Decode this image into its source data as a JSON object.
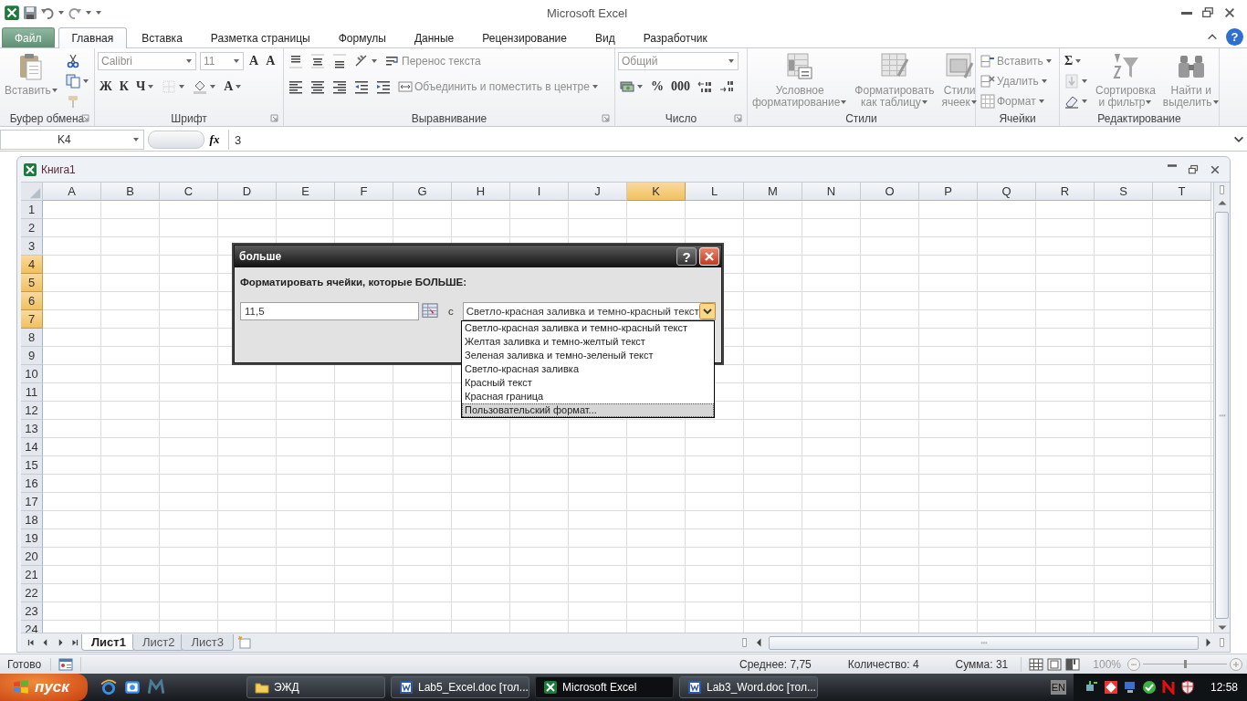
{
  "window": {
    "title": "Microsoft Excel"
  },
  "ribbon_tabs": [
    {
      "label": "Файл",
      "kind": "file",
      "selected": false
    },
    {
      "label": "Главная",
      "kind": "tab",
      "selected": true
    },
    {
      "label": "Вставка",
      "kind": "tab",
      "selected": false
    },
    {
      "label": "Разметка страницы",
      "kind": "tab",
      "selected": false
    },
    {
      "label": "Формулы",
      "kind": "tab",
      "selected": false
    },
    {
      "label": "Данные",
      "kind": "tab",
      "selected": false
    },
    {
      "label": "Рецензирование",
      "kind": "tab",
      "selected": false
    },
    {
      "label": "Вид",
      "kind": "tab",
      "selected": false
    },
    {
      "label": "Разработчик",
      "kind": "tab",
      "selected": false
    }
  ],
  "ribbon_help": "?",
  "ribbon_groups": [
    {
      "label": "Буфер обмена",
      "launcher": true,
      "items": [
        {
          "kind": "large",
          "label": "Вставить",
          "caret": true,
          "disabled": true
        },
        {
          "kind": "stack",
          "items": [
            {
              "kind": "icon",
              "caret": false,
              "disabled": false
            },
            {
              "kind": "icon",
              "caret": true,
              "disabled": false
            },
            {
              "kind": "icon",
              "caret": false,
              "disabled": true
            }
          ]
        }
      ]
    },
    {
      "label": "Шрифт",
      "launcher": true,
      "items": [
        {
          "kind": "rows",
          "lines": [
            {
              "items": [
                {
                  "kind": "combo",
                  "label": "Calibri",
                  "disabled": true
                },
                {
                  "kind": "combo",
                  "label": "11",
                  "disabled": true
                },
                {
                  "kind": "glyph",
                  "label": "A",
                  "caret": false,
                  "disabled": false
                },
                {
                  "kind": "glyph",
                  "label": "A",
                  "caret": false,
                  "disabled": false
                }
              ]
            },
            {
              "items": [
                {
                  "kind": "glyph",
                  "label": "Ж",
                  "caret": false,
                  "disabled": false
                },
                {
                  "kind": "glyph",
                  "label": "К",
                  "caret": false,
                  "disabled": false
                },
                {
                  "kind": "glyph",
                  "label": "Ч",
                  "caret": true,
                  "disabled": false
                },
                {
                  "kind": "icon",
                  "caret": true,
                  "disabled": true
                },
                {
                  "kind": "icon",
                  "caret": true,
                  "disabled": false
                },
                {
                  "kind": "glyph",
                  "label": "A",
                  "caret": true,
                  "disabled": false
                }
              ]
            }
          ]
        }
      ]
    },
    {
      "label": "Выравнивание",
      "launcher": true,
      "items": [
        {
          "kind": "rows",
          "lines": [
            {
              "items": [
                {
                  "kind": "icon",
                  "caret": false,
                  "disabled": false
                },
                {
                  "kind": "icon",
                  "caret": false,
                  "disabled": false
                },
                {
                  "kind": "icon",
                  "caret": false,
                  "disabled": false
                },
                {
                  "kind": "icon",
                  "caret": true,
                  "disabled": false
                },
                {
                  "kind": "labeled",
                  "label": "Перенос текста",
                  "caret": false,
                  "disabled": true
                }
              ]
            },
            {
              "items": [
                {
                  "kind": "icon",
                  "caret": false,
                  "disabled": false
                },
                {
                  "kind": "icon",
                  "caret": false,
                  "disabled": false
                },
                {
                  "kind": "icon",
                  "caret": false,
                  "disabled": false
                },
                {
                  "kind": "icon",
                  "caret": false,
                  "disabled": false
                },
                {
                  "kind": "icon",
                  "caret": false,
                  "disabled": false
                },
                {
                  "kind": "labeled",
                  "label": "Объединить и поместить в центре",
                  "caret": true,
                  "disabled": true
                }
              ]
            }
          ]
        }
      ]
    },
    {
      "label": "Число",
      "launcher": true,
      "items": [
        {
          "kind": "rows",
          "lines": [
            {
              "items": [
                {
                  "kind": "combo",
                  "label": "Общий",
                  "disabled": true
                }
              ]
            },
            {
              "items": [
                {
                  "kind": "icon",
                  "caret": true,
                  "disabled": false
                },
                {
                  "kind": "glyph",
                  "label": "%",
                  "caret": false,
                  "disabled": false
                },
                {
                  "kind": "glyph",
                  "label": "000",
                  "caret": false,
                  "disabled": false
                },
                {
                  "kind": "icon",
                  "caret": false,
                  "disabled": false
                },
                {
                  "kind": "icon",
                  "caret": false,
                  "disabled": false
                }
              ]
            }
          ]
        }
      ]
    },
    {
      "label": "Стили",
      "launcher": false,
      "items": [
        {
          "kind": "large",
          "label": "Условное\nформатирование",
          "caret": true,
          "disabled": true
        },
        {
          "kind": "large",
          "label": "Форматировать\nкак таблицу",
          "caret": true,
          "disabled": true
        },
        {
          "kind": "large",
          "label": "Стили\nячеек",
          "caret": true,
          "disabled": true
        }
      ]
    },
    {
      "label": "Ячейки",
      "launcher": false,
      "items": [
        {
          "kind": "stack",
          "items": [
            {
              "kind": "labeled",
              "label": "Вставить",
              "caret": true,
              "disabled": true
            },
            {
              "kind": "labeled",
              "label": "Удалить",
              "caret": true,
              "disabled": true
            },
            {
              "kind": "labeled",
              "label": "Формат",
              "caret": true,
              "disabled": true
            }
          ]
        }
      ]
    },
    {
      "label": "Редактирование",
      "launcher": false,
      "items": [
        {
          "kind": "stack",
          "items": [
            {
              "kind": "glyph",
              "label": "Σ",
              "caret": true,
              "disabled": false
            },
            {
              "kind": "icon",
              "caret": true,
              "disabled": true
            },
            {
              "kind": "icon",
              "caret": true,
              "disabled": false
            }
          ]
        },
        {
          "kind": "large",
          "label": "Сортировка\nи фильтр",
          "caret": true,
          "disabled": true
        },
        {
          "kind": "large",
          "label": "Найти и\nвыделить",
          "caret": true,
          "disabled": true
        }
      ]
    }
  ],
  "formula_bar": {
    "name_box": "K4",
    "function_button": "fx",
    "value": "3"
  },
  "workbook": {
    "title": "Книга1",
    "columns": [
      {
        "label": "A",
        "selected": false
      },
      {
        "label": "B",
        "selected": false
      },
      {
        "label": "C",
        "selected": false
      },
      {
        "label": "D",
        "selected": false
      },
      {
        "label": "E",
        "selected": false
      },
      {
        "label": "F",
        "selected": false
      },
      {
        "label": "G",
        "selected": false
      },
      {
        "label": "H",
        "selected": false
      },
      {
        "label": "I",
        "selected": false
      },
      {
        "label": "J",
        "selected": false
      },
      {
        "label": "K",
        "selected": true
      },
      {
        "label": "L",
        "selected": false
      },
      {
        "label": "M",
        "selected": false
      },
      {
        "label": "N",
        "selected": false
      },
      {
        "label": "O",
        "selected": false
      },
      {
        "label": "P",
        "selected": false
      },
      {
        "label": "Q",
        "selected": false
      },
      {
        "label": "R",
        "selected": false
      },
      {
        "label": "S",
        "selected": false
      },
      {
        "label": "T",
        "selected": false
      }
    ],
    "rows": [
      {
        "label": "1",
        "selected": false
      },
      {
        "label": "2",
        "selected": false
      },
      {
        "label": "3",
        "selected": false
      },
      {
        "label": "4",
        "selected": true
      },
      {
        "label": "5",
        "selected": true
      },
      {
        "label": "6",
        "selected": true
      },
      {
        "label": "7",
        "selected": true
      },
      {
        "label": "8",
        "selected": false
      },
      {
        "label": "9",
        "selected": false
      },
      {
        "label": "10",
        "selected": false
      },
      {
        "label": "11",
        "selected": false
      },
      {
        "label": "12",
        "selected": false
      },
      {
        "label": "13",
        "selected": false
      },
      {
        "label": "14",
        "selected": false
      },
      {
        "label": "15",
        "selected": false
      },
      {
        "label": "16",
        "selected": false
      },
      {
        "label": "17",
        "selected": false
      },
      {
        "label": "18",
        "selected": false
      },
      {
        "label": "19",
        "selected": false
      },
      {
        "label": "20",
        "selected": false
      },
      {
        "label": "21",
        "selected": false
      },
      {
        "label": "22",
        "selected": false
      },
      {
        "label": "23",
        "selected": false
      },
      {
        "label": "24",
        "selected": false
      }
    ],
    "sheets": [
      {
        "label": "Лист1",
        "selected": true
      },
      {
        "label": "Лист2",
        "selected": false
      },
      {
        "label": "Лист3",
        "selected": false
      }
    ]
  },
  "dialog": {
    "title": "больше",
    "help": "?",
    "prompt": "Форматировать ячейки, которые БОЛЬШЕ:",
    "value": "11,5",
    "connector": "с",
    "format": "Светло-красная заливка и темно-красный текст",
    "options": [
      {
        "label": "Светло-красная заливка и темно-красный текст",
        "selected": false
      },
      {
        "label": "Желтая заливка и темно-желтый текст",
        "selected": false
      },
      {
        "label": "Зеленая заливка и темно-зеленый текст",
        "selected": false
      },
      {
        "label": "Светло-красная заливка",
        "selected": false
      },
      {
        "label": "Красный текст",
        "selected": false
      },
      {
        "label": "Красная граница",
        "selected": false
      },
      {
        "label": "Пользовательский формат...",
        "selected": true
      }
    ]
  },
  "status_bar": {
    "mode": "Готово",
    "stats": [
      "Среднее: 7,75",
      "Количество: 4",
      "Сумма: 31"
    ],
    "zoom": "100%",
    "zoom_slider": {
      "level": 0.5
    }
  },
  "taskbar": {
    "start": "пуск",
    "items": [
      {
        "label": "ЭЖД",
        "kind": "folder",
        "selected": false
      },
      {
        "label": "Lab5_Excel.doc [тол...",
        "kind": "word",
        "selected": false
      },
      {
        "label": "Microsoft Excel",
        "kind": "excel",
        "selected": true
      },
      {
        "label": "Lab3_Word.doc [тол...",
        "kind": "word",
        "selected": false
      }
    ],
    "language": "EN",
    "clock": "12:58"
  }
}
